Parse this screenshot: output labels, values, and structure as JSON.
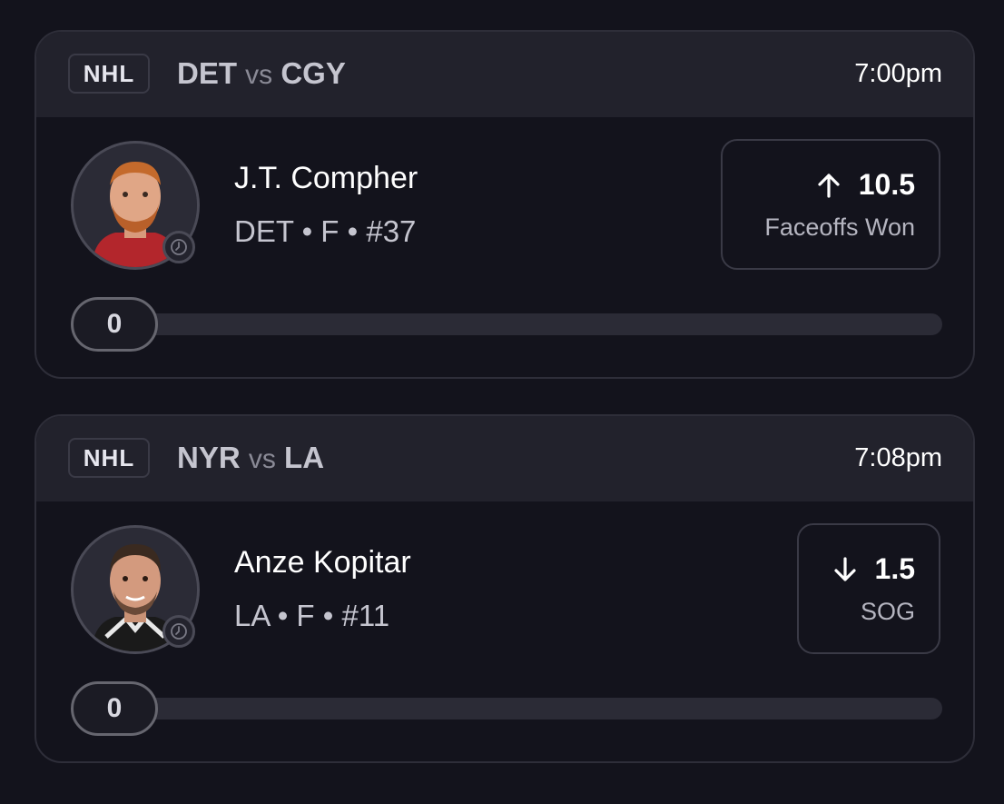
{
  "cards": [
    {
      "league": "NHL",
      "home_team": "DET",
      "vs_label": "vs",
      "away_team": "CGY",
      "time": "7:00pm",
      "player": {
        "name": "J.T. Compher",
        "meta": "DET • F • #37"
      },
      "prop": {
        "direction": "arrow-up-icon",
        "line": "10.5",
        "stat": "Faceoffs Won"
      },
      "progress": {
        "current": "0",
        "fraction": 0
      }
    },
    {
      "league": "NHL",
      "home_team": "NYR",
      "vs_label": "vs",
      "away_team": "LA",
      "time": "7:08pm",
      "player": {
        "name": "Anze Kopitar",
        "meta": "LA • F • #11"
      },
      "prop": {
        "direction": "arrow-down-icon",
        "line": "1.5",
        "stat": "SOG"
      },
      "progress": {
        "current": "0",
        "fraction": 0
      }
    }
  ],
  "colors": {
    "background": "#13131c",
    "header": "#22222c",
    "track": "#2b2b36"
  }
}
